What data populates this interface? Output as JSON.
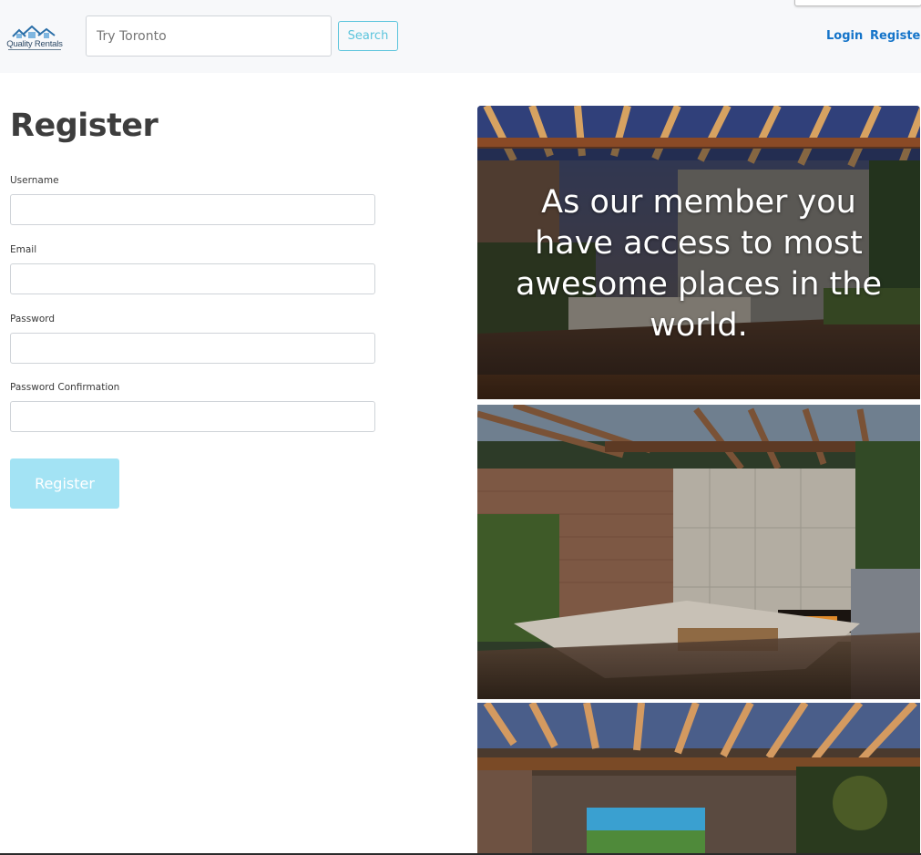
{
  "navbar": {
    "logo_text": "Quality Rentals",
    "search_placeholder": "Try Toronto",
    "search_label": "Search",
    "login_label": "Login",
    "register_label": "Register"
  },
  "form": {
    "title": "Register",
    "fields": [
      {
        "label": "Username",
        "value": ""
      },
      {
        "label": "Email",
        "value": ""
      },
      {
        "label": "Password",
        "value": ""
      },
      {
        "label": "Password Confirmation",
        "value": ""
      }
    ],
    "submit_label": "Register"
  },
  "hero": {
    "text": "As our member you have access to most awesome places in the world."
  },
  "colors": {
    "link": "#1474c9",
    "search_button": "#5bc4dc",
    "submit_button": "#a3e3f4",
    "navbar_bg": "#f7f8fa"
  }
}
